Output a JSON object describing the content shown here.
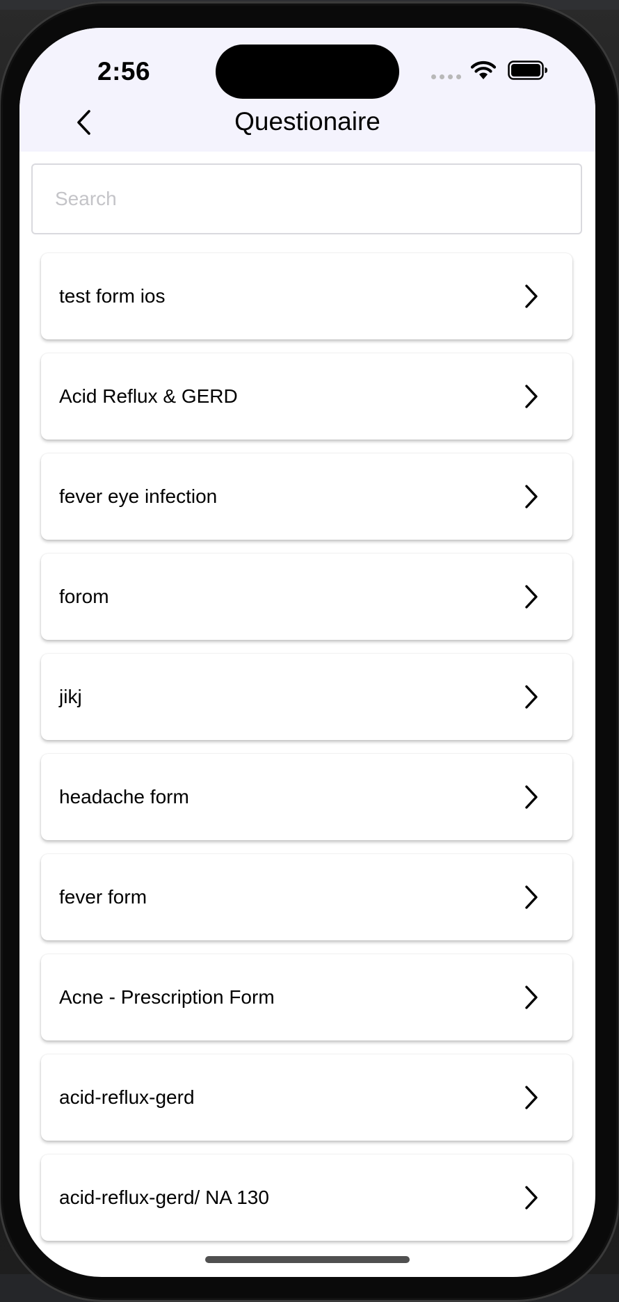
{
  "status_bar": {
    "time": "2:56"
  },
  "nav": {
    "title": "Questionaire",
    "back_icon": "chevron-left-icon"
  },
  "search": {
    "placeholder": "Search",
    "value": ""
  },
  "forms": [
    {
      "label": "test form ios"
    },
    {
      "label": "Acid Reflux & GERD"
    },
    {
      "label": "fever eye infection"
    },
    {
      "label": "forom"
    },
    {
      "label": "jikj"
    },
    {
      "label": "headache form"
    },
    {
      "label": "fever form"
    },
    {
      "label": "Acne - Prescription Form"
    },
    {
      "label": "acid-reflux-gerd"
    },
    {
      "label": "acid-reflux-gerd/ NA 130"
    }
  ],
  "row_icon": "chevron-right-icon",
  "colors": {
    "nav_background": "#f4f3fd",
    "text": "#000000",
    "placeholder": "#c4c4c8"
  }
}
